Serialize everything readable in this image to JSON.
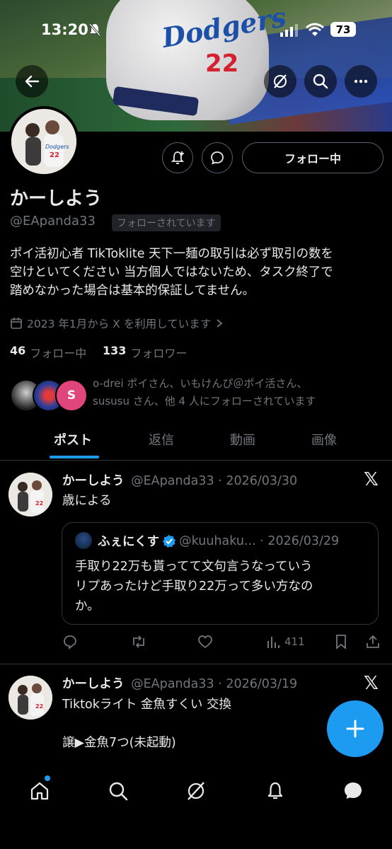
{
  "status_bar": {
    "time": "13:20",
    "battery": "73"
  },
  "profile": {
    "display_name": "かーしよう",
    "handle": "@EApanda33",
    "follows_you_badge": "フォローされています",
    "follow_button": "フォロー中",
    "bio_lines": [
      "ポイ活初心者 TikToklite 天下一麺の取引は必ず取引の数を",
      "空けといてください 当方個人ではないため、タスク終了で",
      "踏めなかった場合は基本的保証してません。"
    ],
    "joined": "2023 年1月から X を利用しています",
    "following_count": "46",
    "following_label": "フォロー中",
    "followers_count": "133",
    "followers_label": "フォロワー",
    "mutual_line1": "o-drei ポイさん、いもけんぴ＠ポイ活さん、",
    "mutual_line2": "sususu さん、他 4 人にフォローされています",
    "mutual_avatar_letter": "S"
  },
  "tabs": [
    {
      "label": "ポスト"
    },
    {
      "label": "返信"
    },
    {
      "label": "動画"
    },
    {
      "label": "画像"
    }
  ],
  "posts": [
    {
      "name": "かーしよう",
      "handle_date": "@EApanda33 · 2026/03/30",
      "text": "歳による",
      "quote": {
        "name": "ふぇにくす",
        "handle_date": "@kuuhaku... · 2026/03/29",
        "lines": [
          "手取り22万も貰ってて文句言うなっていう",
          "リプあったけど手取り22万って多い方なの",
          "か。"
        ]
      },
      "views": "411"
    },
    {
      "name": "かーしよう",
      "handle_date": "@EApanda33 · 2026/03/19",
      "line1": "Tiktokライト 金魚すくい 交換",
      "line2": "譲▶金魚7つ(未起動)"
    }
  ],
  "colors": {
    "accent": "#1d9bf0",
    "muted": "#71767b",
    "border": "#2f3336"
  }
}
